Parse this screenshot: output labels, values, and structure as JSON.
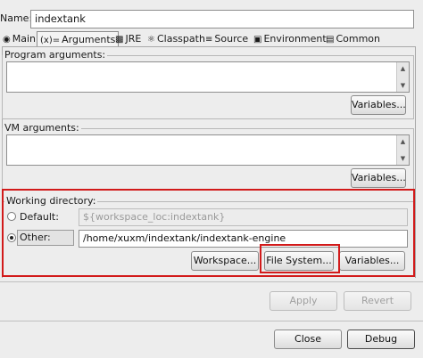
{
  "name": {
    "label": "Name:",
    "value": "indextank"
  },
  "tabs": [
    {
      "label": "Main",
      "icon": "main-tab-icon"
    },
    {
      "label": "Arguments",
      "icon": "arguments-tab-icon"
    },
    {
      "label": "JRE",
      "icon": "jre-tab-icon"
    },
    {
      "label": "Classpath",
      "icon": "classpath-tab-icon"
    },
    {
      "label": "Source",
      "icon": "source-tab-icon"
    },
    {
      "label": "Environment",
      "icon": "environment-tab-icon"
    },
    {
      "label": "Common",
      "icon": "common-tab-icon"
    }
  ],
  "program_args": {
    "label": "Program arguments:",
    "value": "",
    "variables_btn": "Variables..."
  },
  "vm_args": {
    "label": "VM arguments:",
    "value": "",
    "variables_btn": "Variables..."
  },
  "working_dir": {
    "label": "Working directory:",
    "default_label": "Default:",
    "default_value": "${workspace_loc:indextank}",
    "other_label": "Other:",
    "other_value": "/home/xuxm/indextank/indextank-engine",
    "selected": "other",
    "workspace_btn": "Workspace...",
    "filesystem_btn": "File System...",
    "variables_btn": "Variables..."
  },
  "actions": {
    "apply": "Apply",
    "revert": "Revert",
    "close": "Close",
    "debug": "Debug"
  },
  "colors": {
    "highlight": "#d21a1a"
  }
}
